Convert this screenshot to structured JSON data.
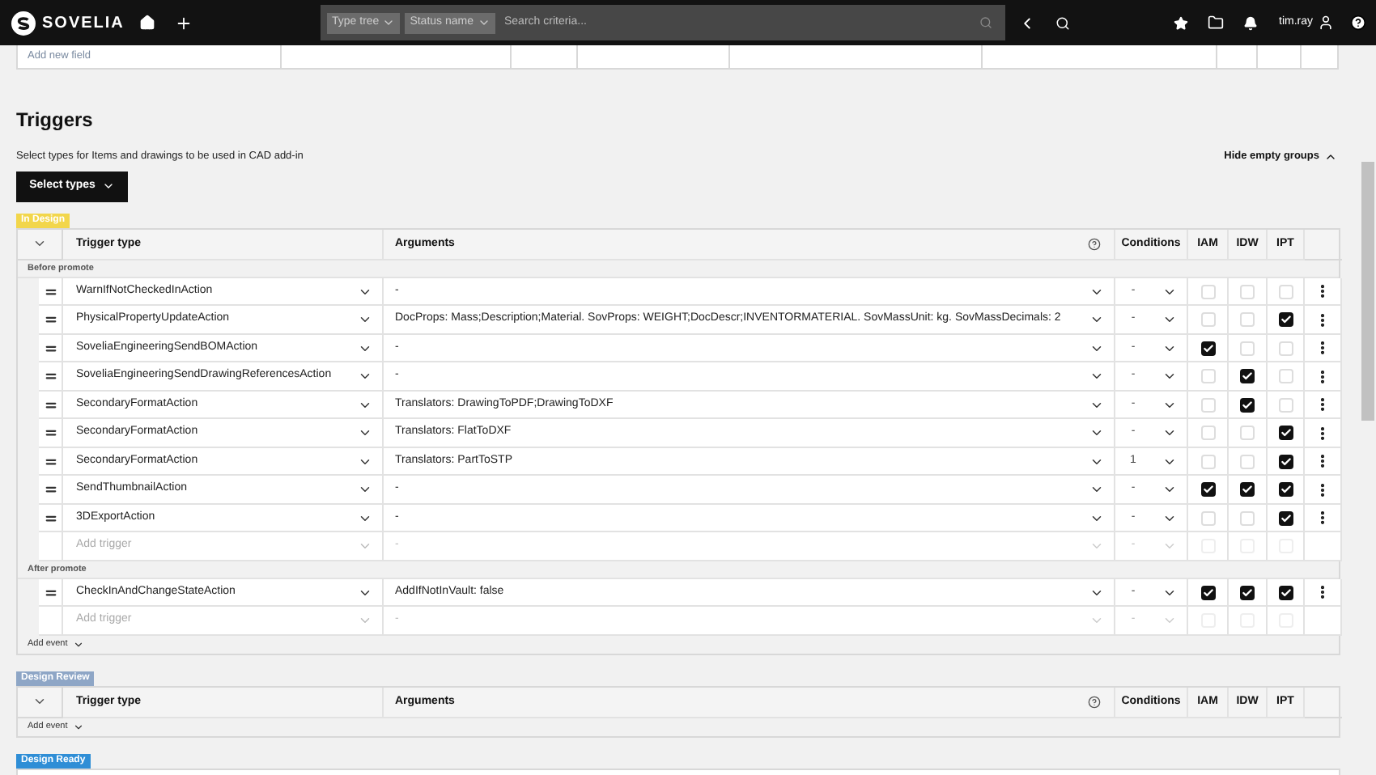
{
  "nav": {
    "brand": "SOVELIA",
    "search_chips": [
      "Type tree",
      "Status name"
    ],
    "search": {
      "placeholder": "Search criteria..."
    },
    "user": "tim.ray"
  },
  "fields_table": {
    "add_row": {
      "placeholder": "Add new field"
    }
  },
  "triggers": {
    "title": "Triggers",
    "description": "Select types for Items and drawings to be used in CAD add-in",
    "select_button": "Select types",
    "hide_toggle": "Hide empty groups"
  },
  "groups": [
    {
      "state": "In Design",
      "color": "#f2d64b",
      "columns": {
        "trigger_type": "Trigger type",
        "arguments": "Arguments",
        "conditions": "Conditions",
        "iam": "IAM",
        "idw": "IDW",
        "ipt": "IPT"
      },
      "events": [
        {
          "name": "Before promote",
          "triggers": [
            {
              "type": "WarnIfNotCheckedInAction",
              "arguments": "-",
              "condition": "-",
              "iam": false,
              "idw": false,
              "ipt": false
            },
            {
              "type": "PhysicalPropertyUpdateAction",
              "arguments": "DocProps: Mass;Description;Material. SovProps: WEIGHT;DocDescr;INVENTORMATERIAL. SovMassUnit: kg. SovMassDecimals: 2",
              "condition": "-",
              "iam": false,
              "idw": false,
              "ipt": true
            },
            {
              "type": "SoveliaEngineeringSendBOMAction",
              "arguments": "-",
              "condition": "-",
              "iam": true,
              "idw": false,
              "ipt": false
            },
            {
              "type": "SoveliaEngineeringSendDrawingReferencesAction",
              "arguments": "-",
              "condition": "-",
              "iam": false,
              "idw": true,
              "ipt": false
            },
            {
              "type": "SecondaryFormatAction",
              "arguments": "Translators: DrawingToPDF;DrawingToDXF",
              "condition": "-",
              "iam": false,
              "idw": true,
              "ipt": false
            },
            {
              "type": "SecondaryFormatAction",
              "arguments": "Translators: FlatToDXF",
              "condition": "-",
              "iam": false,
              "idw": false,
              "ipt": true
            },
            {
              "type": "SecondaryFormatAction",
              "arguments": "Translators: PartToSTP",
              "condition": "1",
              "iam": false,
              "idw": false,
              "ipt": true
            },
            {
              "type": "SendThumbnailAction",
              "arguments": "-",
              "condition": "-",
              "iam": true,
              "idw": true,
              "ipt": true
            },
            {
              "type": "3DExportAction",
              "arguments": "-",
              "condition": "-",
              "iam": false,
              "idw": false,
              "ipt": true
            }
          ],
          "add_trigger": {
            "placeholder": "Add trigger",
            "arguments": "-",
            "condition": "-",
            "disabled": true,
            "iam": false,
            "idw": false,
            "ipt": false
          }
        },
        {
          "name": "After promote",
          "triggers": [
            {
              "type": "CheckInAndChangeStateAction",
              "arguments": "AddIfNotInVault: false",
              "condition": "-",
              "iam": true,
              "idw": true,
              "ipt": true
            }
          ],
          "add_trigger": {
            "placeholder": "Add trigger",
            "arguments": "-",
            "condition": "-",
            "disabled": true,
            "iam": false,
            "idw": false,
            "ipt": false
          }
        }
      ],
      "add_event": "Add event"
    },
    {
      "state": "Design Review",
      "color": "#8ea6c6",
      "columns": {
        "trigger_type": "Trigger type",
        "arguments": "Arguments",
        "conditions": "Conditions",
        "iam": "IAM",
        "idw": "IDW",
        "ipt": "IPT"
      },
      "add_event": "Add event"
    },
    {
      "state": "Design Ready",
      "color": "#2f8ed6"
    }
  ]
}
